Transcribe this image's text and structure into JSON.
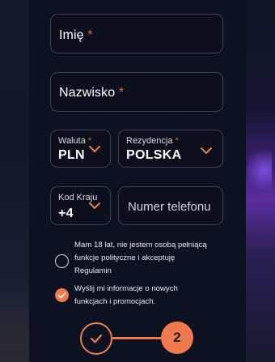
{
  "form": {
    "first_name": {
      "label": "Imię",
      "required_mark": "*"
    },
    "last_name": {
      "label": "Nazwisko",
      "required_mark": "*"
    },
    "currency": {
      "label": "Waluta",
      "required_mark": "*",
      "value": "PLN"
    },
    "residence": {
      "label": "Rezydencja",
      "required_mark": "*",
      "value": "POLSKA"
    },
    "country_code": {
      "label": "Kod Kraju",
      "value": "+4"
    },
    "phone": {
      "placeholder": "Numer telefonu"
    }
  },
  "consents": [
    {
      "lines": [
        "Mam 18 lat, nie jestem osobą pełniącą",
        "funkcje polityczne i akceptuję",
        "Regulamin"
      ],
      "checked": false
    },
    {
      "lines": [
        "Wyślij mi informacje o nowych",
        "funkcjach i promocjach."
      ],
      "checked": true
    }
  ],
  "stepper": {
    "current_step": "2"
  },
  "colors": {
    "accent": "#f07a4c",
    "panel": "#0d1220",
    "field_border": "#3a4150"
  }
}
